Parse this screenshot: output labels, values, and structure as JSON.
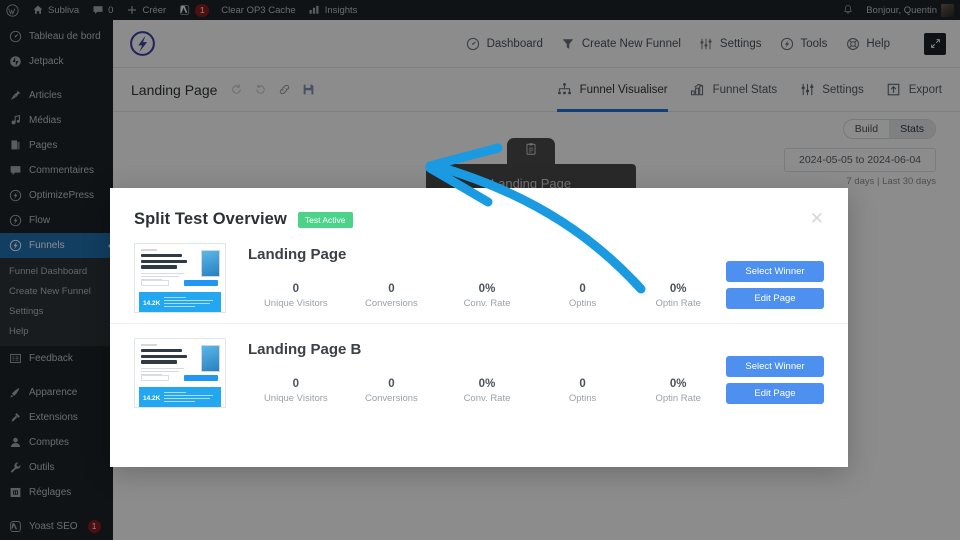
{
  "adminbar": {
    "items": [
      {
        "icon": "wordpress-icon",
        "label": ""
      },
      {
        "icon": "home-icon",
        "label": "Subliva"
      },
      {
        "icon": "comment-icon",
        "label": "0"
      },
      {
        "icon": "plus-icon",
        "label": "Créer"
      },
      {
        "icon": "yoast-icon",
        "label": "",
        "badge": "1"
      },
      {
        "icon": "",
        "label": "Clear OP3 Cache"
      },
      {
        "icon": "bars-chart-icon",
        "label": "Insights"
      }
    ],
    "greeting": "Bonjour, Quentin",
    "notification_icon": "bell-icon",
    "avatar": "user-avatar"
  },
  "sidebar": {
    "items": [
      {
        "icon": "dashboard-icon",
        "label": "Tableau de bord",
        "current": false
      },
      {
        "icon": "jetpack-icon",
        "label": "Jetpack",
        "current": false
      },
      {
        "sep": true
      },
      {
        "icon": "pin-icon",
        "label": "Articles",
        "current": false
      },
      {
        "icon": "media-icon",
        "label": "Médias",
        "current": false
      },
      {
        "icon": "pages-icon",
        "label": "Pages",
        "current": false
      },
      {
        "icon": "comment-icon",
        "label": "Commentaires",
        "current": false
      },
      {
        "icon": "optimizepress-icon",
        "label": "OptimizePress",
        "current": false
      },
      {
        "icon": "optimizepress-icon",
        "label": "Flow",
        "current": false
      },
      {
        "icon": "optimizepress-icon",
        "label": "Funnels",
        "current": true
      }
    ],
    "submenu": [
      {
        "label": "Funnel Dashboard"
      },
      {
        "label": "Create New Funnel"
      },
      {
        "label": "Settings"
      },
      {
        "label": "Help"
      }
    ],
    "items_after": [
      {
        "icon": "feedback-icon",
        "label": "Feedback"
      },
      {
        "sep": true
      },
      {
        "icon": "appearance-icon",
        "label": "Apparence"
      },
      {
        "icon": "plugin-icon",
        "label": "Extensions"
      },
      {
        "icon": "users-icon",
        "label": "Comptes"
      },
      {
        "icon": "tools-icon",
        "label": "Outils"
      },
      {
        "icon": "settings-icon",
        "label": "Réglages"
      },
      {
        "sep": true
      },
      {
        "icon": "yoast-icon",
        "label": "Yoast SEO",
        "badge": "1"
      }
    ]
  },
  "app": {
    "logo": "optimizepress-logo",
    "nav": [
      {
        "icon": "dashboard-circle-icon",
        "label": "Dashboard"
      },
      {
        "icon": "funnel-icon",
        "label": "Create New Funnel"
      },
      {
        "icon": "sliders-icon",
        "label": "Settings"
      },
      {
        "icon": "tools-icon",
        "label": "Tools"
      },
      {
        "icon": "lifebuoy-icon",
        "label": "Help"
      }
    ],
    "expand_icon": "expand-icon",
    "funnel_title": "Landing Page",
    "title_tools": [
      {
        "icon": "undo-icon"
      },
      {
        "icon": "redo-icon"
      },
      {
        "icon": "link-icon"
      },
      {
        "icon": "save-icon"
      }
    ],
    "tabs": [
      {
        "icon": "sitemap-icon",
        "label": "Funnel Visualiser",
        "active": true
      },
      {
        "icon": "bar-chart-icon",
        "label": "Funnel Stats",
        "active": false
      },
      {
        "icon": "sliders-icon",
        "label": "Settings",
        "active": false
      },
      {
        "icon": "export-icon",
        "label": "Export",
        "active": false
      }
    ],
    "mode_toggle": {
      "build": "Build",
      "stats": "Stats",
      "selected": "Stats"
    },
    "date_range": "2024-05-05 to 2024-06-04",
    "quick_dates": "7 days | Last 30 days",
    "node": {
      "icon": "clipboard-icon",
      "label": "Landing Page"
    }
  },
  "modal": {
    "title": "Split Test Overview",
    "badge": "Test Active",
    "badge_color": "#4bd38a",
    "close_icon": "close-icon",
    "button_color": "#4d90f0",
    "stat_labels": [
      "Unique Visitors",
      "Conversions",
      "Conv. Rate",
      "Optins",
      "Optin Rate"
    ],
    "actions": {
      "select_winner": "Select Winner",
      "edit_page": "Edit Page"
    },
    "variants": [
      {
        "name": "Landing Page",
        "thumb": {
          "headline": "30 Objets En Mails Irrésistibles Pour Booster Vos Taux D'ouverture",
          "big_number": "14.2K"
        },
        "stats": [
          "0",
          "0",
          "0%",
          "0",
          "0%"
        ]
      },
      {
        "name": "Landing Page B",
        "thumb": {
          "headline": "30 Objets En Mails Irrésistibles Pour Booster Vos Taux D'ouverture",
          "big_number": "14.2K"
        },
        "stats": [
          "0",
          "0",
          "0%",
          "0",
          "0%"
        ]
      }
    ]
  },
  "annotation": {
    "color": "#1a9ae0",
    "shape": "curved-arrow-pointing-left"
  }
}
